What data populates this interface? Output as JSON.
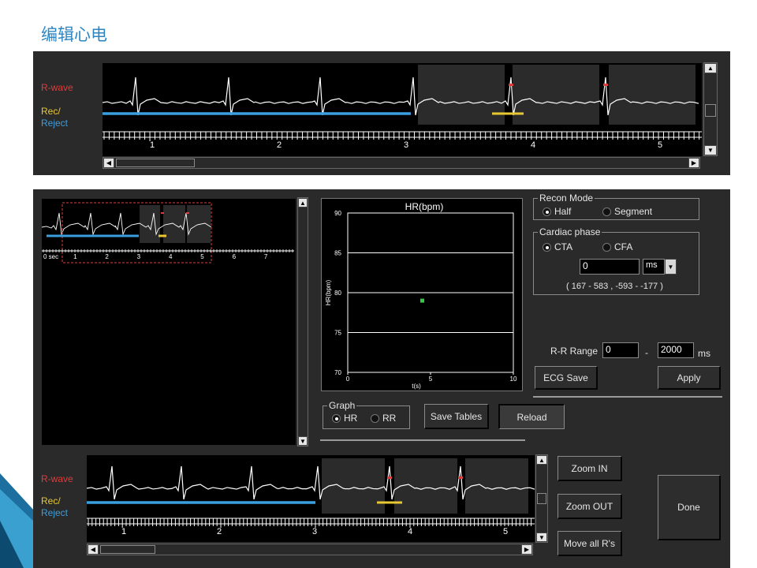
{
  "title": "编辑心电",
  "colors": {
    "rwave": "#e03b3b",
    "rec": "#e8c832",
    "reject": "#3a9fe0",
    "point": "#2ecc40",
    "panel": "#2a2a2a"
  },
  "labels": {
    "rwave": "R-wave",
    "rec": "Rec/",
    "reject": "Reject"
  },
  "top_strip": {
    "ticks": [
      "1",
      "2",
      "3",
      "4",
      "5"
    ]
  },
  "mini_strip": {
    "ticks": [
      "0 sec",
      "1",
      "2",
      "3",
      "4",
      "5",
      "6",
      "7"
    ]
  },
  "bottom_strip": {
    "ticks": [
      "1",
      "2",
      "3",
      "4",
      "5"
    ]
  },
  "chart_data": {
    "type": "scatter",
    "title": "HR(bpm)",
    "xlabel": "t(s)",
    "ylabel": "HR(bpm)",
    "xlim": [
      0,
      10
    ],
    "ylim": [
      70,
      90
    ],
    "x_ticks": [
      "0",
      "5",
      "10"
    ],
    "y_ticks": [
      "90",
      "85",
      "80",
      "75",
      "70"
    ],
    "grid": true,
    "points": [
      {
        "x": 4.5,
        "y": 79
      }
    ]
  },
  "recon_mode": {
    "label": "Recon Mode",
    "options": [
      "Half",
      "Segment"
    ],
    "selected": "Half"
  },
  "cardiac_phase": {
    "label": "Cardiac phase",
    "options": [
      "CTA",
      "CFA"
    ],
    "selected": "CTA",
    "value": "0",
    "unit": "ms",
    "range_text": "( 167 - 583 , -593 - -177 )"
  },
  "rr_range": {
    "label": "R-R Range",
    "min": "0",
    "dash": "-",
    "max": "2000",
    "unit": "ms"
  },
  "buttons": {
    "ecg_save": "ECG Save",
    "apply": "Apply",
    "save_tables": "Save Tables",
    "reload": "Reload",
    "zoom_in": "Zoom IN",
    "zoom_out": "Zoom OUT",
    "move_all": "Move all R's",
    "done": "Done"
  },
  "graph": {
    "label": "Graph",
    "options": [
      "HR",
      "RR"
    ],
    "selected": "HR"
  },
  "icons": {
    "scroll_up": "triangle-up-icon",
    "scroll_down": "triangle-down-icon",
    "scroll_left": "triangle-left-icon",
    "scroll_right": "triangle-right-icon",
    "dropdown": "dropdown-arrow-icon"
  }
}
